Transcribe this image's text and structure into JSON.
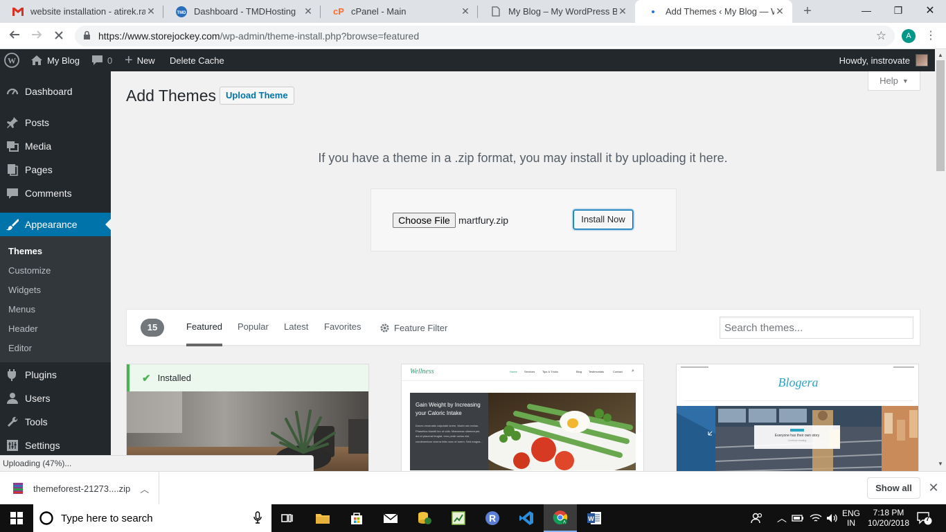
{
  "browser": {
    "tabs": [
      {
        "title": "website installation - atirek.ran",
        "favicon": "gmail-icon"
      },
      {
        "title": "Dashboard - TMDHosting",
        "favicon": "tmdhosting-icon"
      },
      {
        "title": "cPanel - Main",
        "favicon": "cpanel-icon"
      },
      {
        "title": "My Blog – My WordPress Blog",
        "favicon": "page-icon"
      },
      {
        "title": "Add Themes ‹ My Blog — Wor",
        "favicon": "loading-icon"
      }
    ],
    "url_host": "https://www.storejockey.com",
    "url_path": "/wp-admin/theme-install.php?browse=featured",
    "profile_initial": "A"
  },
  "adminbar": {
    "site_name": "My Blog",
    "comments_count": "0",
    "new_label": "New",
    "cache_label": "Delete Cache",
    "howdy": "Howdy, instrovate"
  },
  "sidebar": {
    "items": [
      {
        "label": "Dashboard",
        "icon": "dashboard-icon"
      },
      {
        "label": "Posts",
        "icon": "pin-icon"
      },
      {
        "label": "Media",
        "icon": "media-icon"
      },
      {
        "label": "Pages",
        "icon": "pages-icon"
      },
      {
        "label": "Comments",
        "icon": "comments-icon"
      },
      {
        "label": "Appearance",
        "icon": "brush-icon"
      },
      {
        "label": "Plugins",
        "icon": "plugin-icon"
      },
      {
        "label": "Users",
        "icon": "users-icon"
      },
      {
        "label": "Tools",
        "icon": "wrench-icon"
      },
      {
        "label": "Settings",
        "icon": "settings-icon"
      }
    ],
    "submenu": [
      "Themes",
      "Customize",
      "Widgets",
      "Menus",
      "Header",
      "Editor"
    ]
  },
  "page": {
    "title": "Add Themes",
    "upload_button": "Upload Theme",
    "help_label": "Help",
    "upload_description": "If you have a theme in a .zip format, you may install it by uploading it here.",
    "choose_file_label": "Choose File",
    "file_name": "martfury.zip",
    "install_label": "Install Now"
  },
  "filter": {
    "count": "15",
    "tabs": [
      "Featured",
      "Popular",
      "Latest",
      "Favorites"
    ],
    "feature_filter": "Feature Filter",
    "search_placeholder": "Search themes..."
  },
  "themes": {
    "installed_label": "Installed",
    "wellness": {
      "brand": "Wellness",
      "nav": [
        "Home",
        "Services",
        "Tips & Tricks",
        "Blog",
        "Testimonials",
        "Contact"
      ],
      "headline": "Gain Weight by Increasing your Caloric Intake",
      "body": "Donec venenatis vulputate lorem. Morbi nec metus. Phasellus blandit leo ut odio. Maecenas ullamcorper, dui et placerat feugiat, eros pede varius nisi, condimentum viverra felis nunc et lorem. Sed magna..."
    },
    "blogera": {
      "brand": "Blogera",
      "caption": "Everyone has their own story",
      "cta": "Continue reading"
    }
  },
  "status": {
    "uploading": "Uploading (47%)..."
  },
  "downloads": {
    "file": "themeforest-21273....zip",
    "show_all": "Show all"
  },
  "taskbar": {
    "search_placeholder": "Type here to search",
    "lang_line1": "ENG",
    "lang_line2": "IN",
    "time": "7:18 PM",
    "date": "10/20/2018",
    "notif_count": "7"
  },
  "colors": {
    "wp_dark": "#23282d",
    "wp_blue": "#0073aa",
    "installed_green": "#46b450"
  }
}
